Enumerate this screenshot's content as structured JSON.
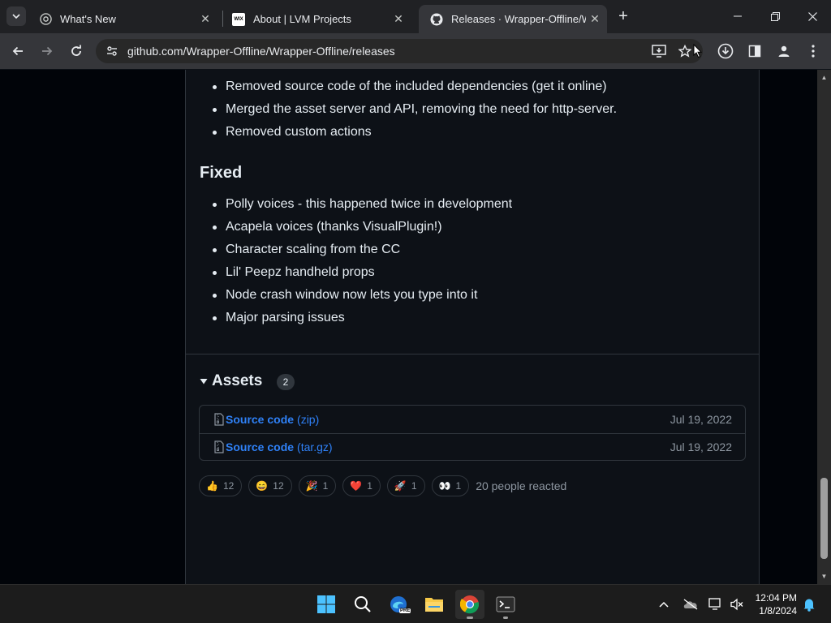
{
  "browser": {
    "tabs": [
      {
        "title": "What's New",
        "favicon": "chrome-icon"
      },
      {
        "title": "About | LVM Projects",
        "favicon": "wix-icon",
        "favicon_text": "WIX"
      },
      {
        "title": "Releases · Wrapper-Offline/Wra",
        "favicon": "github-icon",
        "active": true
      }
    ],
    "url": "github.com/Wrapper-Offline/Wrapper-Offline/releases"
  },
  "release": {
    "changes_items": [
      "Removed source code of the included dependencies (get it online)",
      "Merged the asset server and API, removing the need for http-server.",
      "Removed custom actions"
    ],
    "fixed_heading": "Fixed",
    "fixed_items": [
      "Polly voices - this happened twice in development",
      "Acapela voices (thanks VisualPlugin!)",
      "Character scaling from the CC",
      "Lil' Peepz handheld props",
      "Node crash window now lets you type into it",
      "Major parsing issues"
    ],
    "assets": {
      "title": "Assets",
      "count": "2",
      "files": [
        {
          "name": "Source code",
          "ext": "(zip)",
          "date": "Jul 19, 2022"
        },
        {
          "name": "Source code",
          "ext": "(tar.gz)",
          "date": "Jul 19, 2022"
        }
      ]
    },
    "reactions": [
      {
        "emoji": "👍",
        "name": "thumbs-up",
        "count": "12"
      },
      {
        "emoji": "😄",
        "name": "laugh",
        "count": "12"
      },
      {
        "emoji": "🎉",
        "name": "hooray",
        "count": "1"
      },
      {
        "emoji": "❤️",
        "name": "heart",
        "count": "1"
      },
      {
        "emoji": "🚀",
        "name": "rocket",
        "count": "1"
      },
      {
        "emoji": "👀",
        "name": "eyes",
        "count": "1"
      }
    ],
    "reactions_summary": "20 people reacted"
  },
  "taskbar": {
    "time": "12:04 PM",
    "date": "1/8/2024",
    "edge_badge": "PRE"
  },
  "colors": {
    "link": "#2f81f7",
    "page_bg": "#0d1117",
    "border": "#30363d"
  }
}
